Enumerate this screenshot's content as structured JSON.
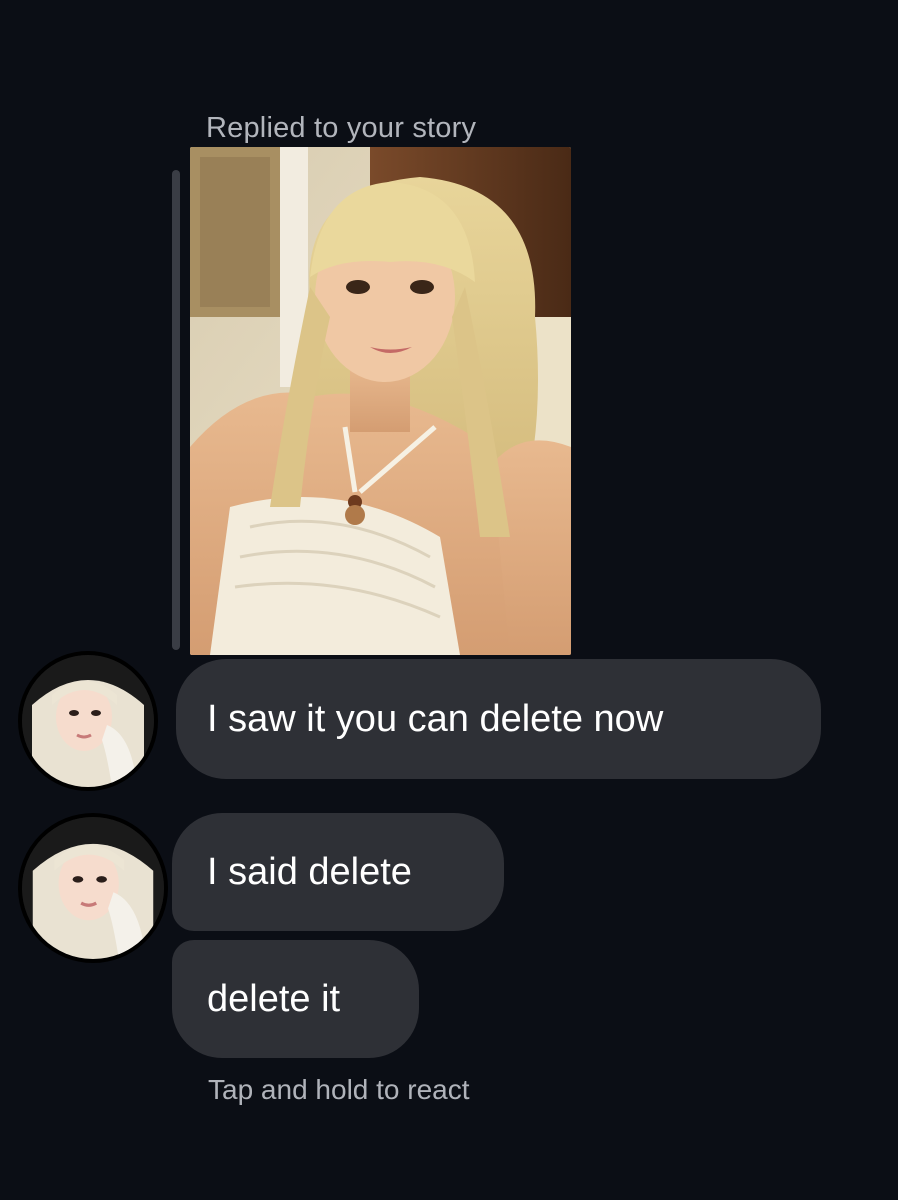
{
  "conversation": {
    "reply_context": "Replied to your story",
    "story": {
      "description": "story-photo"
    },
    "messages": [
      {
        "text": "I saw it you can delete now",
        "sender": "friend",
        "shows_avatar": true
      },
      {
        "text": "I said delete",
        "sender": "friend",
        "shows_avatar": true
      },
      {
        "text": "delete it",
        "sender": "friend",
        "shows_avatar": false
      }
    ],
    "footer_hint": "Tap and hold to react"
  },
  "colors": {
    "background": "#0b0e15",
    "bubble": "#2e3036",
    "secondary_text": "#b2b5bc",
    "message_text": "#ffffff"
  },
  "icons": {
    "avatar": "profile-photo"
  }
}
